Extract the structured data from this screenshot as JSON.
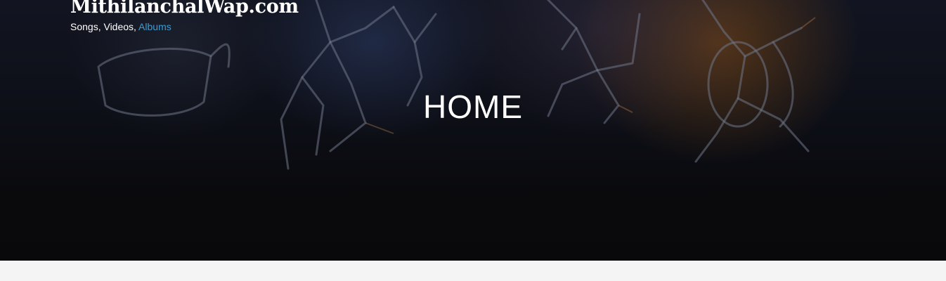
{
  "header": {
    "site_title": "MithilanchalWap.com",
    "tagline": {
      "songs": "Songs, ",
      "videos": "Videos, ",
      "albums": "Albums"
    }
  },
  "hero": {
    "heading": "HOME"
  },
  "colors": {
    "link_accent": "#3e9bd0",
    "content_background": "#f4f4f4"
  }
}
